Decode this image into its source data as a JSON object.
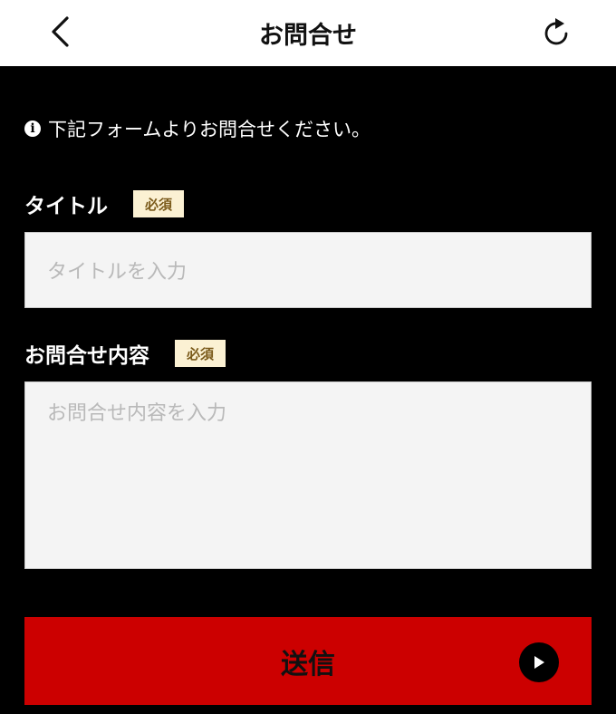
{
  "header": {
    "title": "お問合せ",
    "back_icon": "chevron-left-icon",
    "reload_icon": "reload-icon"
  },
  "notice": {
    "icon": "info-icon",
    "text": "下記フォームよりお問合せください。"
  },
  "form": {
    "title_field": {
      "label": "タイトル",
      "badge": "必須",
      "placeholder": "タイトルを入力"
    },
    "content_field": {
      "label": "お問合せ内容",
      "badge": "必須",
      "placeholder": "お問合せ内容を入力"
    }
  },
  "submit": {
    "label": "送信",
    "icon": "play-circle-icon"
  },
  "colors": {
    "background": "#000000",
    "header_bg": "#ffffff",
    "accent_red": "#cc0000",
    "badge_bg": "#fbf1d3",
    "badge_text": "#7a5a1a",
    "input_bg": "#f4f4f4"
  }
}
